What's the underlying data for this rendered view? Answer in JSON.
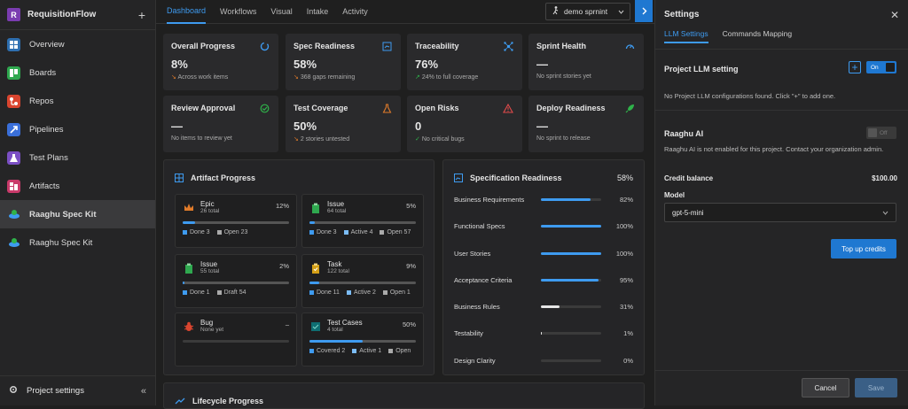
{
  "app": {
    "initial": "R",
    "title": "RequisitionFlow",
    "add_symbol": "+"
  },
  "sidebar": {
    "items": [
      {
        "label": "Overview"
      },
      {
        "label": "Boards"
      },
      {
        "label": "Repos"
      },
      {
        "label": "Pipelines"
      },
      {
        "label": "Test Plans"
      },
      {
        "label": "Artifacts"
      },
      {
        "label": "Raaghu Spec Kit"
      },
      {
        "label": "Raaghu Spec Kit"
      }
    ],
    "footer": {
      "label": "Project settings",
      "collapse": "«"
    }
  },
  "topnav": {
    "tabs": [
      {
        "label": "Dashboard"
      },
      {
        "label": "Workflows"
      },
      {
        "label": "Visual"
      },
      {
        "label": "Intake"
      },
      {
        "label": "Activity"
      }
    ],
    "sprint": "demo sprnint"
  },
  "cards": [
    {
      "title": "Overall Progress",
      "value": "8%",
      "sub": "Across work items",
      "color": "#3e9bf0"
    },
    {
      "title": "Spec Readiness",
      "value": "58%",
      "sub": "368 gaps remaining",
      "color": "#3e9bf0"
    },
    {
      "title": "Traceability",
      "value": "76%",
      "sub": "24% to full coverage",
      "color": "#3e9bf0"
    },
    {
      "title": "Sprint Health",
      "value": "—",
      "sub": "No sprint stories yet",
      "color": "#3e9bf0"
    },
    {
      "title": "Review Approval",
      "value": "—",
      "sub": "No items to review yet",
      "color": "#2fb34a"
    },
    {
      "title": "Test Coverage",
      "value": "50%",
      "sub": "2 stories untested",
      "color": "#e07b2a"
    },
    {
      "title": "Open Risks",
      "value": "0",
      "sub": "No critical bugs",
      "color": "#e04a4a"
    },
    {
      "title": "Deploy Readiness",
      "value": "—",
      "sub": "No sprint to release",
      "color": "#2fb34a"
    }
  ],
  "artifact_progress": {
    "title": "Artifact Progress",
    "items": [
      {
        "name": "Epic",
        "sub": "26 total",
        "pct": "12%",
        "fill": 0.12,
        "legend": [
          "Done 3",
          "Open 23"
        ]
      },
      {
        "name": "Issue",
        "sub": "64 total",
        "pct": "5%",
        "fill": 0.05,
        "legend": [
          "Done 3",
          "Active 4",
          "Open 57"
        ]
      },
      {
        "name": "Issue",
        "sub": "55 total",
        "pct": "2%",
        "fill": 0.02,
        "legend": [
          "Done 1",
          "Draft 54"
        ]
      },
      {
        "name": "Task",
        "sub": "122 total",
        "pct": "9%",
        "fill": 0.09,
        "legend": [
          "Done 11",
          "Active 2",
          "Open 1"
        ]
      },
      {
        "name": "Bug",
        "sub": "None yet",
        "pct": "–",
        "fill": 0,
        "legend": []
      },
      {
        "name": "Test Cases",
        "sub": "4 total",
        "pct": "50%",
        "fill": 0.5,
        "legend": [
          "Covered 2",
          "Active 1",
          "Open"
        ]
      }
    ]
  },
  "spec_readiness": {
    "title": "Specification Readiness",
    "pct": "58%",
    "rows": [
      {
        "label": "Business Requirements",
        "pct": "82%",
        "fill": 0.82
      },
      {
        "label": "Functional Specs",
        "pct": "100%",
        "fill": 1.0
      },
      {
        "label": "User Stories",
        "pct": "100%",
        "fill": 1.0
      },
      {
        "label": "Acceptance Criteria",
        "pct": "95%",
        "fill": 0.95
      },
      {
        "label": "Business Rules",
        "pct": "31%",
        "fill": 0.31
      },
      {
        "label": "Testability",
        "pct": "1%",
        "fill": 0.01
      },
      {
        "label": "Design Clarity",
        "pct": "0%",
        "fill": 0
      }
    ]
  },
  "lifecycle": {
    "title": "Lifecycle Progress"
  },
  "settings": {
    "title": "Settings",
    "tabs": [
      {
        "label": "LLM Settings"
      },
      {
        "label": "Commands Mapping"
      }
    ],
    "project_llm": {
      "title": "Project LLM setting",
      "toggle": "On",
      "add": "+",
      "empty": "No Project LLM configurations found. Click \"+\" to add one."
    },
    "raaghu": {
      "title": "Raaghu AI",
      "toggle": "Off",
      "desc": "Raaghu AI is not enabled for this project. Contact your organization admin."
    },
    "credit": {
      "label": "Credit balance",
      "value": "$100.00"
    },
    "model": {
      "label": "Model",
      "value": "gpt-5-mini"
    },
    "topup": "Top up credits",
    "cancel": "Cancel",
    "save": "Save"
  }
}
